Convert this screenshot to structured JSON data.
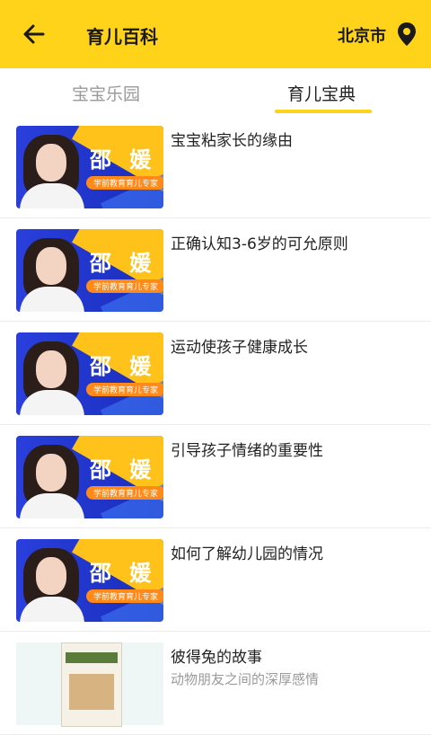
{
  "header": {
    "title": "育儿百科",
    "city": "北京市",
    "bg_color": "#FFD31A"
  },
  "tabs": [
    {
      "label": "宝宝乐园",
      "active": false
    },
    {
      "label": "育儿宝典",
      "active": true
    }
  ],
  "thumbnail": {
    "name": "邵 媛",
    "tag": "学前教育育儿专家"
  },
  "articles": [
    {
      "title": "宝宝粘家长的缘由",
      "subtitle": ""
    },
    {
      "title": "正确认知3-6岁的可允原则",
      "subtitle": ""
    },
    {
      "title": "运动使孩子健康成长",
      "subtitle": ""
    },
    {
      "title": "引导孩子情绪的重要性",
      "subtitle": ""
    },
    {
      "title": "如何了解幼儿园的情况",
      "subtitle": ""
    },
    {
      "title": "彼得兔的故事",
      "subtitle": "动物朋友之间的深厚感情"
    }
  ]
}
